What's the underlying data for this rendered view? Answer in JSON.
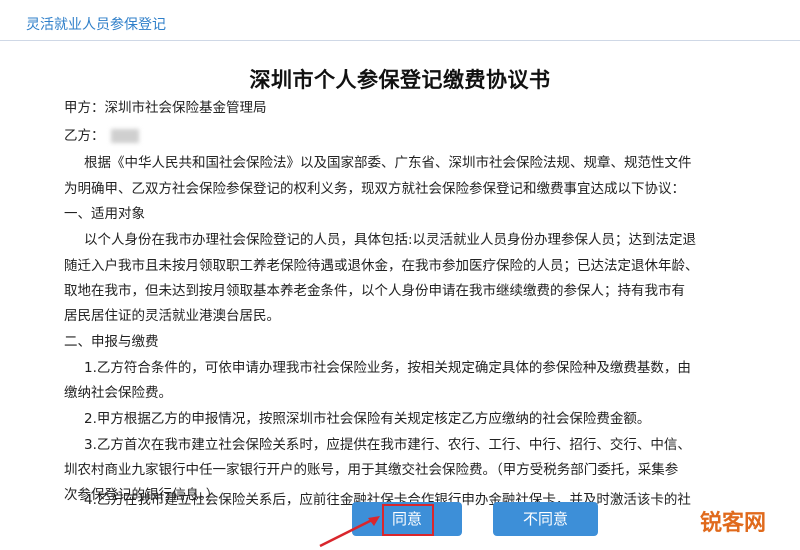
{
  "header": {
    "title": "灵活就业人员参保登记"
  },
  "document": {
    "title": "深圳市个人参保登记缴费协议书",
    "party_a": "甲方：深圳市社会保险基金管理局",
    "party_b_label": "乙方：",
    "lines": [
      "根据《中华人民共和国社会保险法》以及国家部委、广东省、深圳市社会保险法规、规章、规范性文件",
      "为明确甲、乙双方社会保险参保登记的权利义务，现双方就社会保险参保登记和缴费事宜达成以下协议：",
      "一、适用对象",
      "以个人身份在我市办理社会保险登记的人员，具体包括:以灵活就业人员身份办理参保人员；达到法定退",
      "随迁入户我市且未按月领取职工养老保险待遇或退休金，在我市参加医疗保险的人员；已达法定退休年龄、",
      "取地在我市，但未达到按月领取基本养老金条件，以个人身份申请在我市继续缴费的参保人；持有我市有",
      "居民居住证的灵活就业港澳台居民。",
      "二、申报与缴费",
      "1.乙方符合条件的，可依申请办理我市社会保险业务，按相关规定确定具体的参保险种及缴费基数，由",
      "缴纳社会保险费。",
      "2.甲方根据乙方的申报情况，按照深圳市社会保险有关规定核定乙方应缴纳的社会保险费金额。",
      "3.乙方首次在我市建立社会保险关系时，应提供在我市建行、农行、工行、中行、招行、交行、中信、",
      "圳农村商业九家银行中任一家银行开户的账号，用于其缴交社会保险费。（甲方受税务部门委托，采集参",
      "次参保登记的银行信息。）",
      "4.乙方在我市建立社会保险关系后，应前往金融社保卡合作银行申办金融社保卡，并及时激活该卡的社"
    ]
  },
  "buttons": {
    "agree": "同意",
    "disagree": "不同意"
  },
  "watermark": "锐客网"
}
